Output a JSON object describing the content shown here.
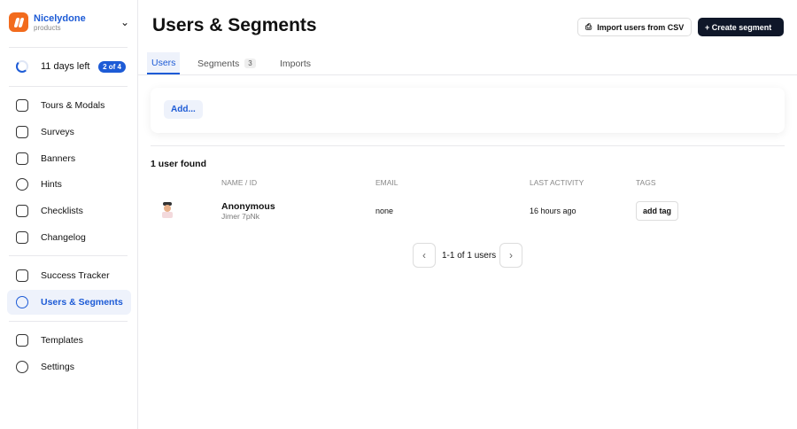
{
  "brand": {
    "name": "Nicelydone",
    "sub": "products"
  },
  "trial": {
    "text": "11 days left",
    "badge": "2 of 4"
  },
  "nav": [
    {
      "label": "Tours & Modals"
    },
    {
      "label": "Surveys"
    },
    {
      "label": "Banners"
    },
    {
      "label": "Hints"
    },
    {
      "label": "Checklists"
    },
    {
      "label": "Changelog"
    },
    {
      "label": "Success Tracker"
    },
    {
      "label": "Users & Segments"
    },
    {
      "label": "Templates"
    },
    {
      "label": "Settings"
    }
  ],
  "header": {
    "title": "Users & Segments",
    "import": "Import users from CSV",
    "create": "+ Create segment"
  },
  "tabs": [
    {
      "label": "Users"
    },
    {
      "label": "Segments",
      "count": "3"
    },
    {
      "label": "Imports"
    }
  ],
  "filter": {
    "add": "Add..."
  },
  "results": {
    "count": "1 user found",
    "columns": [
      "NAME / ID",
      "EMAIL",
      "LAST ACTIVITY",
      "TAGS"
    ],
    "rows": [
      {
        "name": "Anonymous",
        "id": "Jimer 7pNk",
        "email": "none",
        "last": "16 hours ago",
        "tag": "add tag"
      }
    ]
  },
  "pagination": {
    "text": "1-1 of 1 users",
    "prev": "‹",
    "next": "›"
  }
}
